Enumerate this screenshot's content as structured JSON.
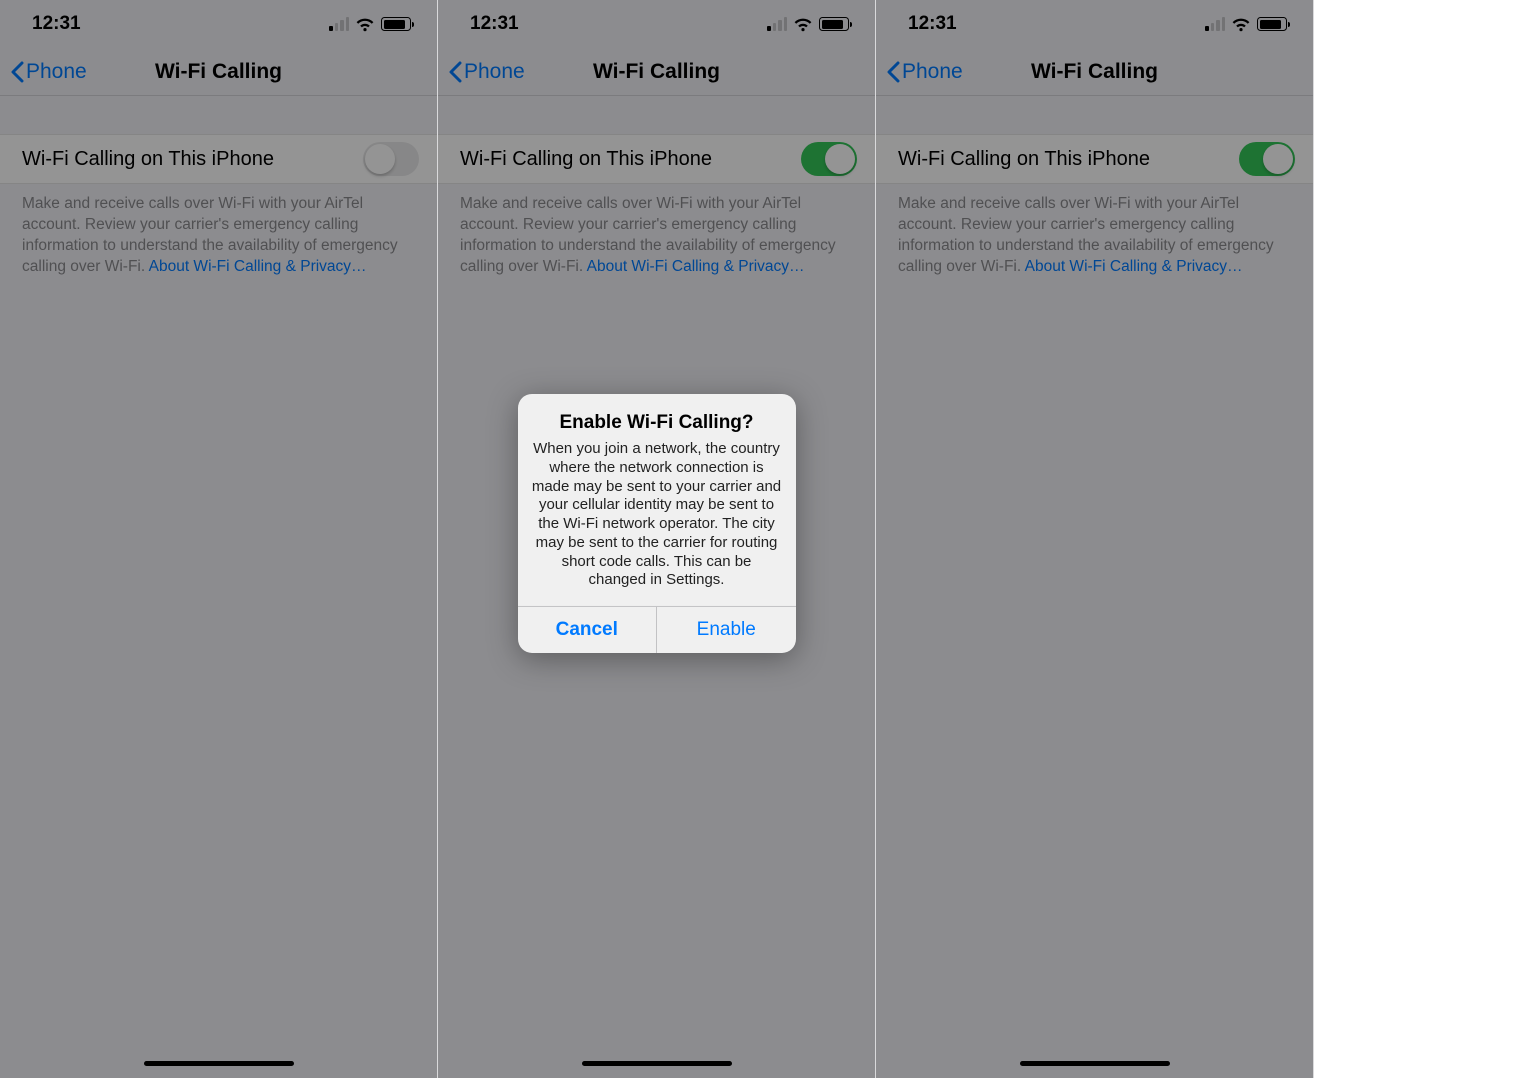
{
  "status": {
    "time": "12:31"
  },
  "nav": {
    "back": "Phone",
    "title": "Wi-Fi Calling"
  },
  "row": {
    "label": "Wi-Fi Calling on This iPhone"
  },
  "footer": {
    "text": "Make and receive calls over Wi-Fi with your AirTel account. Review your carrier's emergency calling information to understand the availability of emergency calling over Wi-Fi. ",
    "link": "About Wi-Fi Calling & Privacy…"
  },
  "alert": {
    "title": "Enable Wi-Fi Calling?",
    "message": "When you join a network, the country where the network connection is made may be sent to your carrier and your cellular identity may be sent to the Wi-Fi network operator. The city may be sent to the carrier for routing short code calls. This can be changed in Settings.",
    "cancel": "Cancel",
    "enable": "Enable"
  }
}
